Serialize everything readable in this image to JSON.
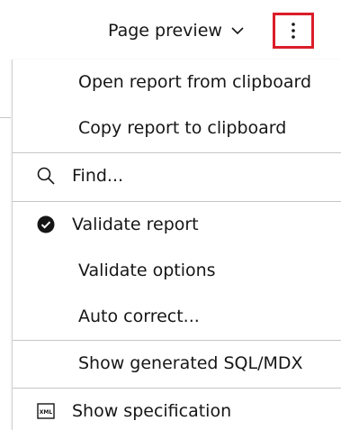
{
  "toolbar": {
    "view_select_label": "Page preview",
    "view_select_icon": "chevron-down-icon",
    "more_icon": "overflow-menu-vertical-icon",
    "highlight_color": "#da1e28"
  },
  "menu": {
    "items": [
      {
        "label": "Open report from clipboard",
        "icon": ""
      },
      {
        "label": "Copy report to clipboard",
        "icon": ""
      },
      {
        "label": "Find...",
        "icon": "search-icon"
      },
      {
        "label": "Validate report",
        "icon": "checkmark-filled-icon"
      },
      {
        "label": "Validate options",
        "icon": ""
      },
      {
        "label": "Auto correct...",
        "icon": ""
      },
      {
        "label": "Show generated SQL/MDX",
        "icon": ""
      },
      {
        "label": "Show specification",
        "icon": "xml-icon"
      }
    ],
    "xml_icon_text": "XML"
  }
}
